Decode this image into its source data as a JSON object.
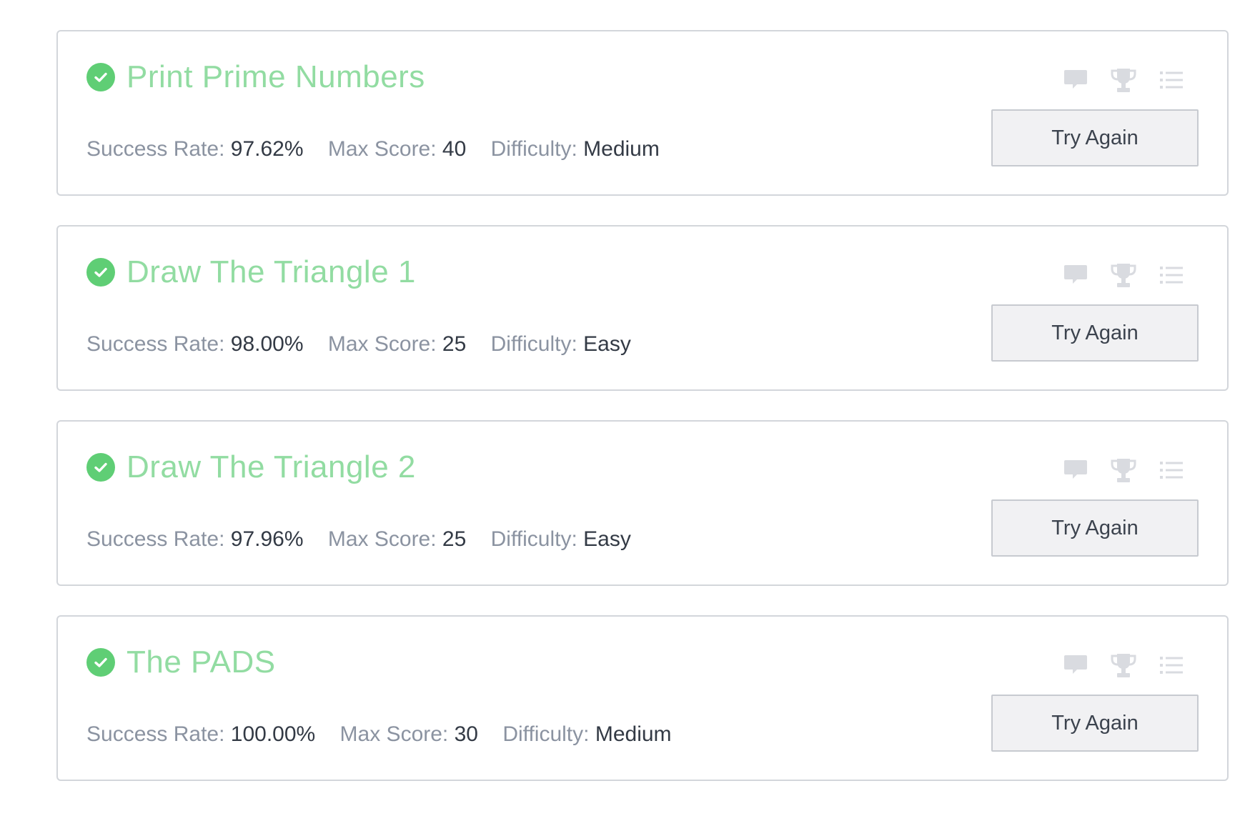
{
  "colors": {
    "accent_green": "#5fce75",
    "title_green": "#92dca2",
    "label_gray": "#8b93a1",
    "value_dark": "#333a45",
    "icon_gray": "#d9dbe0"
  },
  "icons": [
    "discussion-icon",
    "leaderboard-trophy-icon",
    "editorial-list-icon"
  ],
  "labels": {
    "success_rate": "Success Rate:",
    "max_score": "Max Score:",
    "difficulty": "Difficulty:"
  },
  "challenges": [
    {
      "title": "Print Prime Numbers",
      "status": "solved",
      "success_rate": "97.62%",
      "max_score": "40",
      "difficulty": "Medium",
      "button": "Try Again"
    },
    {
      "title": "Draw The Triangle 1",
      "status": "solved",
      "success_rate": "98.00%",
      "max_score": "25",
      "difficulty": "Easy",
      "button": "Try Again"
    },
    {
      "title": "Draw The Triangle 2",
      "status": "solved",
      "success_rate": "97.96%",
      "max_score": "25",
      "difficulty": "Easy",
      "button": "Try Again"
    },
    {
      "title": "The PADS",
      "status": "solved",
      "success_rate": "100.00%",
      "max_score": "30",
      "difficulty": "Medium",
      "button": "Try Again"
    }
  ]
}
